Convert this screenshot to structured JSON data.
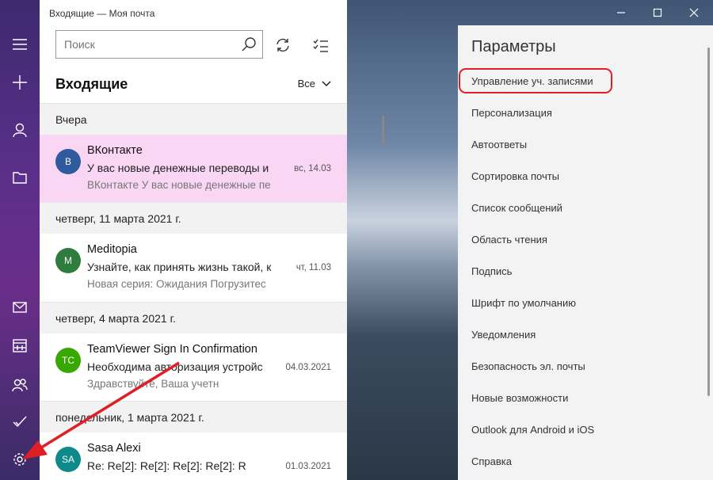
{
  "window": {
    "title": "Входящие — Моя почта"
  },
  "search": {
    "placeholder": "Поиск"
  },
  "list": {
    "folder_title": "Входящие",
    "filter_label": "Все"
  },
  "groups": [
    {
      "label": "Вчера"
    },
    {
      "label": "четверг, 11 марта 2021 г."
    },
    {
      "label": "четверг, 4 марта 2021 г."
    },
    {
      "label": "понедельник, 1 марта 2021 г."
    }
  ],
  "messages": [
    {
      "initials": "В",
      "avatar_color": "#2f5a9e",
      "sender": "ВКонтакте",
      "subject": "У вас новые денежные переводы и",
      "date": "вс, 14.03",
      "preview": "ВКонтакте У вас новые денежные пе",
      "selected": true
    },
    {
      "initials": "M",
      "avatar_color": "#2e7d3e",
      "sender": "Meditopia",
      "subject": "Узнайте, как принять жизнь такой, к",
      "date": "чт, 11.03",
      "preview": "Новая серия: Ожидания Погрузитес",
      "selected": false
    },
    {
      "initials": "TC",
      "avatar_color": "#36a800",
      "sender": "TeamViewer Sign In Confirmation",
      "subject": "Необходима авторизация устройс",
      "date": "04.03.2021",
      "preview": "Здравствуйте, Ваша учетн",
      "selected": false
    },
    {
      "initials": "SA",
      "avatar_color": "#0f8a8a",
      "sender": "Sasa Alexi",
      "subject": "Re: Re[2]: Re[2]: Re[2]: Re[2]: R",
      "date": "01.03.2021",
      "preview": "",
      "selected": false
    }
  ],
  "settings": {
    "title": "Параметры",
    "items": [
      "Управление уч. записями",
      "Персонализация",
      "Автоответы",
      "Сортировка почты",
      "Список сообщений",
      "Область чтения",
      "Подпись",
      "Шрифт по умолчанию",
      "Уведомления",
      "Безопасность эл. почты",
      "Новые возможности",
      "Outlook для Android и iOS",
      "Справка"
    ]
  },
  "rail_icons": [
    "hamburger-icon",
    "new-mail-icon",
    "accounts-icon",
    "folders-icon",
    "mail-icon",
    "calendar-icon",
    "people-icon",
    "todo-icon",
    "settings-gear-icon"
  ],
  "colors": {
    "selected_row": "#f9d6f4",
    "annotation": "#e01e26"
  }
}
